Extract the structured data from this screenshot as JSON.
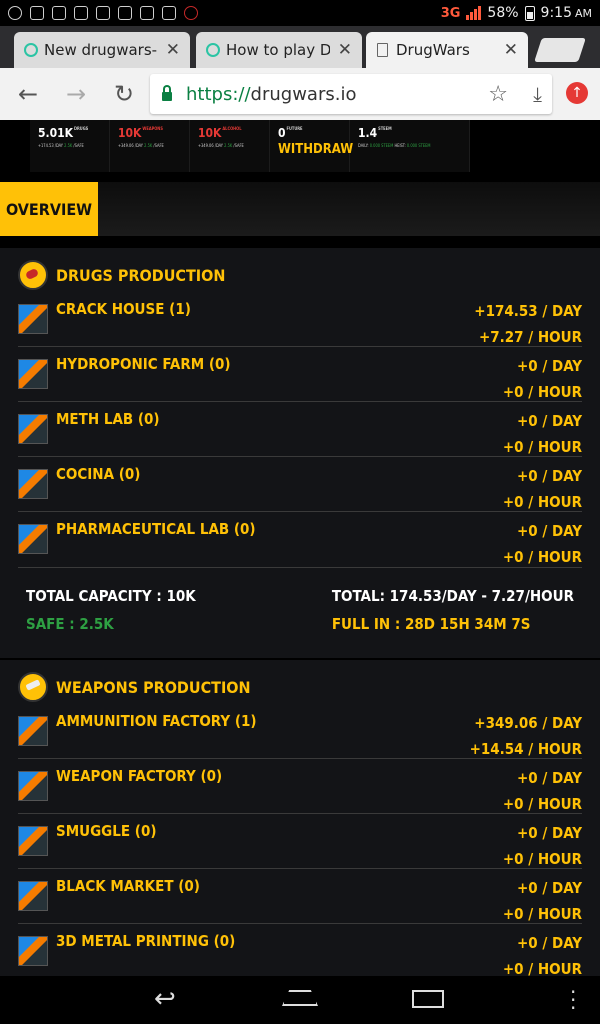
{
  "status_bar": {
    "network": "3G",
    "battery": "58%",
    "time": "9:15",
    "time_suffix": "AM"
  },
  "tabs": [
    {
      "title": "New drugwars-",
      "favicon": "drugwars-favicon"
    },
    {
      "title": "How to play Dru",
      "favicon": "drugwars-favicon"
    },
    {
      "title": "DrugWars",
      "favicon": "page-icon"
    }
  ],
  "address_bar": {
    "scheme": "https://",
    "host": "drugwars.io"
  },
  "stats": {
    "drugs": {
      "value": "5.01K",
      "label": "DRUGS",
      "sub": "+174.53 /DAY",
      "safe": "2.5K",
      "safe_label": "/SAFE"
    },
    "weapons": {
      "value": "10K",
      "label": "WEAPONS",
      "sub": "+349.06 /DAY",
      "safe": "2.5K",
      "safe_label": "/SAFE"
    },
    "alcohol": {
      "value": "10K",
      "label": "ALCOHOL",
      "sub": "+349.06 /DAY",
      "safe": "2.5K",
      "safe_label": "/SAFE"
    },
    "future": {
      "value": "0",
      "label": "FUTURE",
      "action": "WITHDRAW"
    },
    "steem": {
      "value": "1.4",
      "label": "STEEM",
      "sub": "DAILY:",
      "daily": "0.000 STEEM",
      "heist_label": "HEIST:",
      "heist": "0.000 STEEM"
    }
  },
  "overview_label": "OVERVIEW",
  "drugs_panel": {
    "title": "DRUGS PRODUCTION",
    "rows": [
      {
        "name": "CRACK HOUSE (1)",
        "per_day": "+174.53 / DAY",
        "per_hour": "+7.27 / HOUR"
      },
      {
        "name": "HYDROPONIC FARM (0)",
        "per_day": "+0 / DAY",
        "per_hour": "+0 / HOUR"
      },
      {
        "name": "METH LAB (0)",
        "per_day": "+0 / DAY",
        "per_hour": "+0 / HOUR"
      },
      {
        "name": "COCINA (0)",
        "per_day": "+0 / DAY",
        "per_hour": "+0 / HOUR"
      },
      {
        "name": "PHARMACEUTICAL LAB (0)",
        "per_day": "+0 / DAY",
        "per_hour": "+0 / HOUR"
      }
    ],
    "total_capacity": "TOTAL CAPACITY : 10K",
    "safe": "SAFE : 2.5K",
    "total": "TOTAL: 174.53/DAY - 7.27/HOUR",
    "full_in": "FULL IN : 28D 15H 34M 7S"
  },
  "weapons_panel": {
    "title": "WEAPONS PRODUCTION",
    "rows": [
      {
        "name": "AMMUNITION FACTORY (1)",
        "per_day": "+349.06 / DAY",
        "per_hour": "+14.54 / HOUR"
      },
      {
        "name": "WEAPON FACTORY (0)",
        "per_day": "+0 / DAY",
        "per_hour": "+0 / HOUR"
      },
      {
        "name": "SMUGGLE (0)",
        "per_day": "+0 / DAY",
        "per_hour": "+0 / HOUR"
      },
      {
        "name": "BLACK MARKET (0)",
        "per_day": "+0 / DAY",
        "per_hour": "+0 / HOUR"
      },
      {
        "name": "3D METAL PRINTING (0)",
        "per_day": "+0 / DAY",
        "per_hour": "+0 / HOUR"
      }
    ]
  },
  "colors": {
    "accent": "#ffc107",
    "safe_green": "#2ea043",
    "alert_red": "#e53935",
    "secure_green": "#0b8043"
  }
}
